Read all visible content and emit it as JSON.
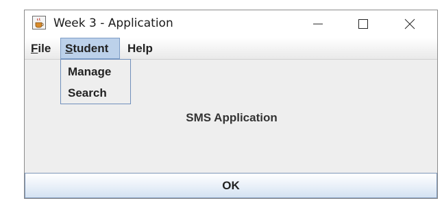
{
  "window": {
    "title": "Week 3 - Application",
    "icon": "java-cup-icon",
    "controls": [
      "minimize-icon",
      "maximize-icon",
      "close-icon"
    ]
  },
  "menubar": {
    "file": {
      "mnemonic": "F",
      "rest": "ile"
    },
    "student": {
      "mnemonic": "S",
      "rest": "tudent"
    },
    "help": "Help"
  },
  "dropdown": {
    "items": [
      "Manage",
      "Search"
    ]
  },
  "main": {
    "label": "SMS Application"
  },
  "button": {
    "ok": "OK"
  },
  "colors": {
    "accent": "#bcd1ea",
    "background": "#eeeeee"
  }
}
